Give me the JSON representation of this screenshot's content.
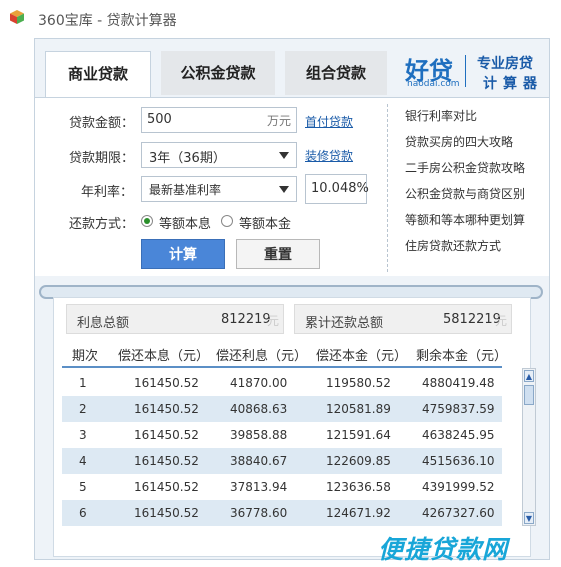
{
  "window": {
    "title": "360宝库 - 贷款计算器"
  },
  "tabs": [
    {
      "label": "商业贷款",
      "active": true
    },
    {
      "label": "公积金贷款",
      "active": false
    },
    {
      "label": "组合贷款",
      "active": false
    }
  ],
  "logo": {
    "mark": "好贷",
    "domain": "haodai.com",
    "line1": "专业房贷",
    "line2": "计算器"
  },
  "form": {
    "amount_label": "贷款金额：",
    "amount_value": "500",
    "amount_unit": "万元",
    "amount_link": "首付贷款",
    "term_label": "贷款期限：",
    "term_value": "3年（36期）",
    "term_link": "装修贷款",
    "rate_label": "年利率：",
    "rate_value": "最新基准利率",
    "rate_percent": "10.048%",
    "method_label": "还款方式：",
    "method_options": [
      "等额本息",
      "等额本金"
    ],
    "method_selected": 0,
    "calc_label": "计算",
    "reset_label": "重置"
  },
  "side_links": [
    "银行利率对比",
    "贷款买房的四大攻略",
    "二手房公积金贷款攻略",
    "公积金贷款与商贷区别",
    "等额和等本哪种更划算",
    "住房贷款还款方式"
  ],
  "summary": {
    "interest_label": "利息总额",
    "interest_value": "812219",
    "interest_unit": "元",
    "total_label": "累计还款总额",
    "total_value": "5812219",
    "total_unit": "元"
  },
  "table": {
    "headers": [
      "期次",
      "偿还本息（元）",
      "偿还利息（元）",
      "偿还本金（元）",
      "剩余本金（元）"
    ],
    "rows": [
      [
        "1",
        "161450.52",
        "41870.00",
        "119580.52",
        "4880419.48"
      ],
      [
        "2",
        "161450.52",
        "40868.63",
        "120581.89",
        "4759837.59"
      ],
      [
        "3",
        "161450.52",
        "39858.88",
        "121591.64",
        "4638245.95"
      ],
      [
        "4",
        "161450.52",
        "38840.67",
        "122609.85",
        "4515636.10"
      ],
      [
        "5",
        "161450.52",
        "37813.94",
        "123636.58",
        "4391999.52"
      ],
      [
        "6",
        "161450.52",
        "36778.60",
        "124671.92",
        "4267327.60"
      ]
    ]
  },
  "watermark": "便捷贷款网",
  "colors": {
    "accent": "#4a86d8",
    "row_alt": "#dde9f3",
    "logo": "#1f6fbf",
    "watermark": "#18a6d8"
  }
}
